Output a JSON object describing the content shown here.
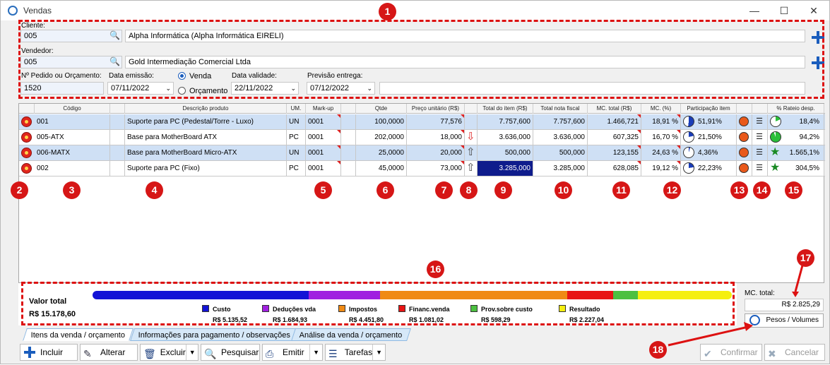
{
  "window": {
    "title": "Vendas",
    "minimize": "—",
    "maximize": "☐",
    "close": "✕"
  },
  "header": {
    "cliente_label": "Cliente:",
    "cliente_code": "005",
    "cliente_name": "Alpha Informática (Alpha Informática EIRELI)",
    "vendedor_label": "Vendedor:",
    "vendedor_code": "005",
    "vendedor_name": "Gold Intermediação Comercial Ltda",
    "pedido_label": "Nº Pedido ou Orçamento:",
    "pedido_value": "1520",
    "emissao_label": "Data emissão:",
    "emissao_value": "07/11/2022",
    "radio_venda": "Venda",
    "radio_orcamento": "Orçamento",
    "validade_label": "Data validade:",
    "validade_value": "22/11/2022",
    "previsao_label": "Previsão entrega:",
    "previsao_value": "07/12/2022"
  },
  "columns": [
    "Código",
    "Descrição produto",
    "UM.",
    "Mark-up",
    "Qtde",
    "Preço unitário (R$)",
    "Total do item (R$)",
    "Total nota fiscal",
    "MC. total (R$)",
    "MC. (%)",
    "Participação item",
    "% Rateio desp."
  ],
  "rows": [
    {
      "codigo": "001",
      "descricao": "Suporte para PC (Pedestal/Torre - Luxo)",
      "um": "UN",
      "markup": "0001",
      "qtde": "100,0000",
      "preco": "77,576",
      "total": "7.757,600",
      "nota": "7.757,600",
      "mc": "1.466,721",
      "mcp": "18,91 %",
      "part": "51,91%",
      "rateio": "18,4%",
      "arrow": "",
      "selected": true
    },
    {
      "codigo": "005-ATX",
      "descricao": "Base para MotherBoard ATX",
      "um": "PC",
      "markup": "0001",
      "qtde": "202,0000",
      "preco": "18,000",
      "total": "3.636,000",
      "nota": "3.636,000",
      "mc": "607,325",
      "mcp": "16,70 %",
      "part": "21,50%",
      "rateio": "94,2%",
      "arrow": "down",
      "selected": false
    },
    {
      "codigo": "006-MATX",
      "descricao": "Base para MotherBoard Micro-ATX",
      "um": "UN",
      "markup": "0001",
      "qtde": "25,0000",
      "preco": "20,000",
      "total": "500,000",
      "nota": "500,000",
      "mc": "123,155",
      "mcp": "24,63 %",
      "part": "4,36%",
      "rateio": "1.565,1%",
      "arrow": "up",
      "selected": true
    },
    {
      "codigo": "002",
      "descricao": "Suporte para PC (Fixo)",
      "um": "PC",
      "markup": "0001",
      "qtde": "45,0000",
      "preco": "73,000",
      "total": "3.285,000",
      "nota": "3.285,000",
      "mc": "628,085",
      "mcp": "19,12 %",
      "part": "22,23%",
      "rateio": "304,5%",
      "arrow": "up",
      "selected": false
    }
  ],
  "badges": [
    "1",
    "2",
    "3",
    "4",
    "5",
    "6",
    "7",
    "8",
    "9",
    "10",
    "11",
    "12",
    "13",
    "14",
    "15",
    "16",
    "17",
    "18"
  ],
  "summary": {
    "valor_label": "Valor total",
    "valor_value": "R$ 15.178,60",
    "legend": [
      {
        "label": "Custo",
        "value": "R$ 5.135,52",
        "color": "#1313d6"
      },
      {
        "label": "Deduções vda",
        "value": "R$ 1.684,93",
        "color": "#a020e0"
      },
      {
        "label": "Impostos",
        "value": "R$ 4.451,80",
        "color": "#f08a14"
      },
      {
        "label": "Financ.venda",
        "value": "R$ 1.081,02",
        "color": "#e81414"
      },
      {
        "label": "Prov.sobre custo",
        "value": "R$ 598,29",
        "color": "#4cc040"
      },
      {
        "label": "Resultado",
        "value": "R$ 2.227,04",
        "color": "#f5ef10"
      }
    ],
    "mc_label": "MC. total:",
    "mc_value": "R$ 2.825,29",
    "pesos_label": "Pesos / Volumes"
  },
  "tabs": [
    "Itens da venda / orçamento",
    "Informações para pagamento / observações",
    "Análise da venda / orçamento"
  ],
  "toolbar": {
    "incluir": "Incluir",
    "alterar": "Alterar",
    "excluir": "Excluir",
    "pesquisar": "Pesquisar",
    "emitir": "Emitir",
    "tarefas": "Tarefas",
    "confirmar": "Confirmar",
    "cancelar": "Cancelar"
  }
}
